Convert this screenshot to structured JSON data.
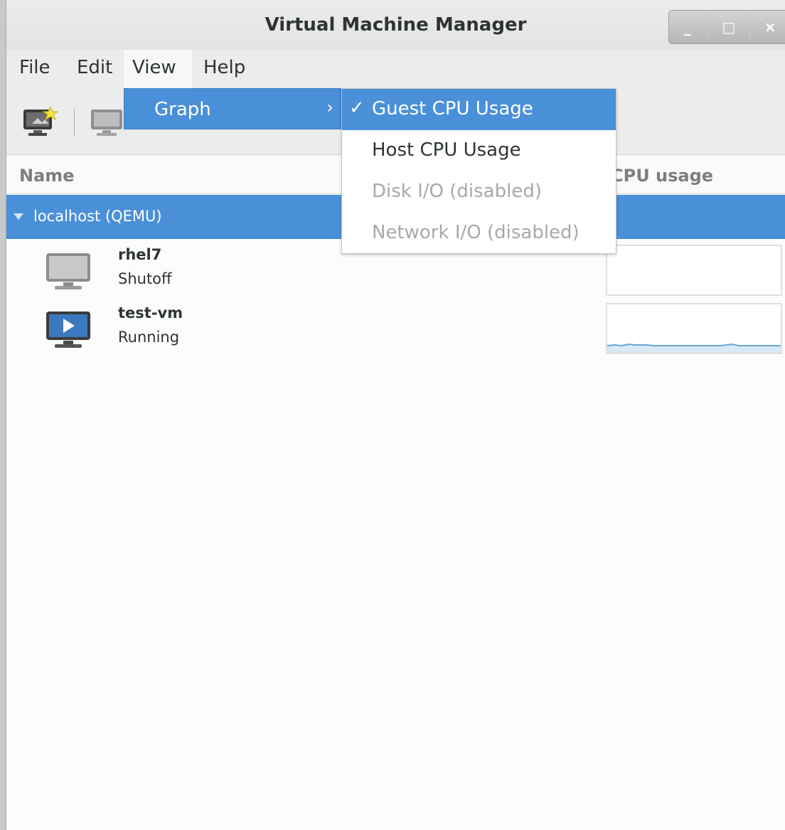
{
  "window": {
    "title": "Virtual Machine Manager",
    "controls": {
      "minimize": "_",
      "maximize": "□",
      "close": "×"
    }
  },
  "menubar": {
    "items": [
      {
        "label": "File"
      },
      {
        "label": "Edit"
      },
      {
        "label": "View"
      },
      {
        "label": "Help"
      }
    ]
  },
  "view_menu": {
    "items": [
      {
        "label": "Graph",
        "submenu_arrow": "›"
      }
    ]
  },
  "graph_submenu": {
    "items": [
      {
        "label": "Guest CPU Usage",
        "checked": true,
        "check_glyph": "✓",
        "enabled": true
      },
      {
        "label": "Host CPU Usage",
        "checked": false,
        "enabled": true
      },
      {
        "label": "Disk I/O (disabled)",
        "checked": false,
        "enabled": false
      },
      {
        "label": "Network I/O (disabled)",
        "checked": false,
        "enabled": false
      }
    ]
  },
  "table": {
    "columns": {
      "name": "Name",
      "cpu": "CPU usage"
    },
    "host": {
      "label": "localhost (QEMU)"
    },
    "vms": [
      {
        "name": "rhel7",
        "status": "Shutoff",
        "icon": "monitor-off-icon"
      },
      {
        "name": "test-vm",
        "status": "Running",
        "icon": "monitor-running-icon"
      }
    ]
  },
  "colors": {
    "selection": "#4a90d9",
    "graph_line": "#6aa6d4"
  }
}
